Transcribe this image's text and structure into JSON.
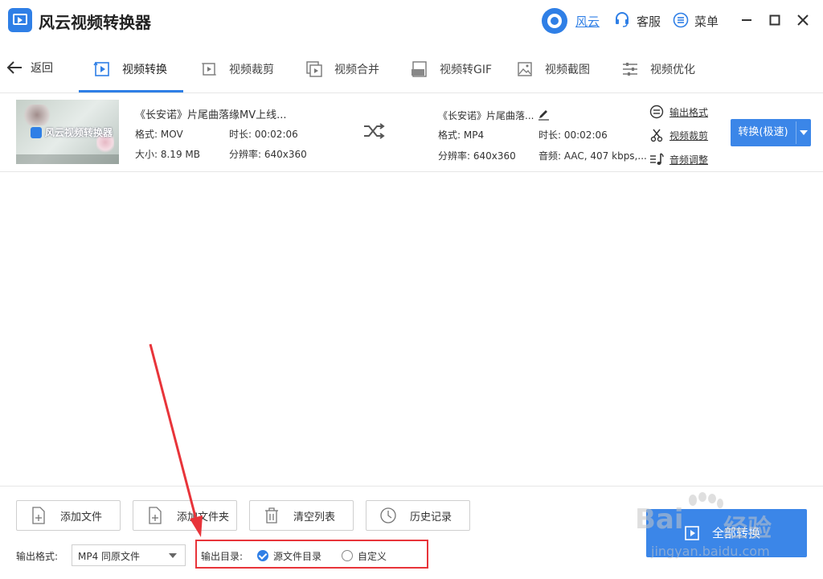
{
  "app": {
    "title": "风云视频转换器",
    "user_label": "风云",
    "service_label": "客服",
    "menu_label": "菜单"
  },
  "nav": {
    "back_label": "返回",
    "tabs": [
      {
        "label": "视频转换",
        "icon": "video-convert-icon",
        "active": true
      },
      {
        "label": "视频裁剪",
        "icon": "video-crop-icon"
      },
      {
        "label": "视频合并",
        "icon": "video-merge-icon"
      },
      {
        "label": "视频转GIF",
        "icon": "gif-icon"
      },
      {
        "label": "视频截图",
        "icon": "screenshot-icon"
      },
      {
        "label": "视频优化",
        "icon": "optimize-icon"
      }
    ]
  },
  "file": {
    "thumbnail_watermark": "风云视频转换器",
    "source": {
      "name": "《长安诺》片尾曲落缘MV上线...",
      "format": "格式: MOV",
      "duration": "时长: 00:02:06",
      "size": "大小: 8.19 MB",
      "resolution": "分辨率: 640x360"
    },
    "output": {
      "name": "《长安诺》片尾曲落...",
      "format": "格式: MP4",
      "duration": "时长: 00:02:06",
      "resolution": "分辨率: 640x360",
      "audio": "音频: AAC, 407 kbps,..."
    },
    "links": {
      "output_format": "输出格式",
      "video_crop": "视频裁剪",
      "audio_adjust": "音频调整"
    },
    "convert_label": "转换(极速)"
  },
  "bottom": {
    "add_file": "添加文件",
    "add_folder": "添加文件夹",
    "clear_list": "清空列表",
    "history": "历史记录",
    "output_format_label": "输出格式:",
    "output_format_value": "MP4 同原文件",
    "output_dir_label": "输出目录:",
    "dir_option_source": "源文件目录",
    "dir_option_custom": "自定义",
    "convert_all": "全部转换"
  },
  "watermark": {
    "brand": "Bai",
    "brand_cn": "经验",
    "url": "jingyan.baidu.com"
  },
  "colors": {
    "accent": "#2f7fe6",
    "annotation": "#e8343a"
  }
}
